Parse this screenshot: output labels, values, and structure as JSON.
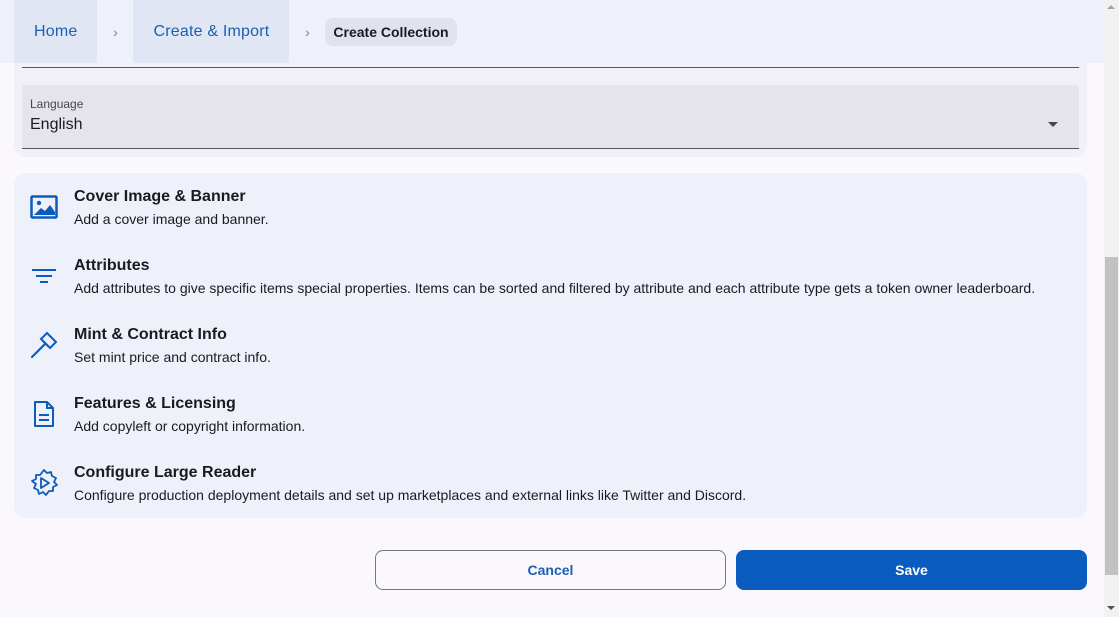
{
  "breadcrumb": {
    "items": [
      {
        "label": "Home"
      },
      {
        "label": "Create & Import"
      }
    ],
    "current": "Create Collection",
    "separator": "›"
  },
  "language_field": {
    "label": "Language",
    "value": "English"
  },
  "sections": [
    {
      "title": "Cover Image & Banner",
      "description": "Add a cover image and banner.",
      "icon": "image-icon"
    },
    {
      "title": "Attributes",
      "description": "Add attributes to give specific items special properties. Items can be sorted and filtered by attribute and each attribute type gets a token owner leaderboard.",
      "icon": "filter-list-icon"
    },
    {
      "title": "Mint & Contract Info",
      "description": "Set mint price and contract info.",
      "icon": "hammer-icon"
    },
    {
      "title": "Features & Licensing",
      "description": "Add copyleft or copyright information.",
      "icon": "document-icon"
    },
    {
      "title": "Configure Large Reader",
      "description": "Configure production deployment details and set up marketplaces and external links like Twitter and Discord.",
      "icon": "settings-play-icon"
    }
  ],
  "actions": {
    "cancel_label": "Cancel",
    "save_label": "Save"
  },
  "colors": {
    "accent": "#0b5cbf",
    "link": "#1a5fb4",
    "icon": "#0b5cbf"
  }
}
